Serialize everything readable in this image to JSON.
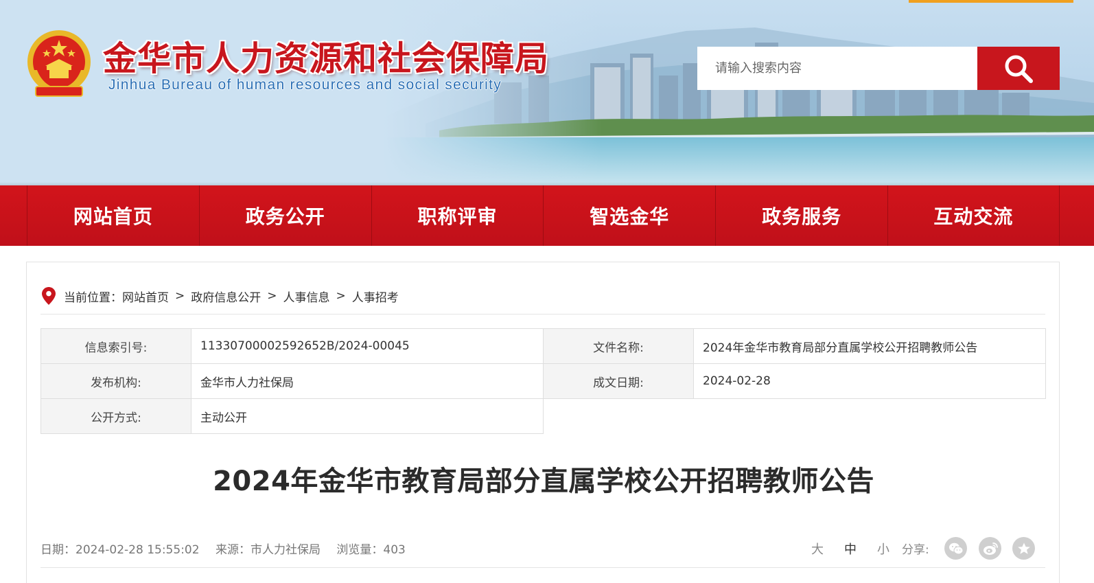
{
  "header": {
    "title": "金华市人力资源和社会保障局",
    "subtitle": "Jinhua Bureau of human resources and social security",
    "search_placeholder": "请输入搜索内容"
  },
  "nav": {
    "items": [
      {
        "label": "网站首页"
      },
      {
        "label": "政务公开"
      },
      {
        "label": "职称评审"
      },
      {
        "label": "智选金华"
      },
      {
        "label": "政务服务"
      },
      {
        "label": "互动交流"
      }
    ]
  },
  "breadcrumb": {
    "prefix": "当前位置：",
    "items": [
      "网站首页",
      "政府信息公开",
      "人事信息",
      "人事招考"
    ],
    "separator": ">"
  },
  "meta": {
    "index_label": "信息索引号:",
    "index_value": "11330700002592652B/2024-00045",
    "filename_label": "文件名称:",
    "filename_value": "2024年金华市教育局部分直属学校公开招聘教师公告",
    "publisher_label": "发布机构:",
    "publisher_value": "金华市人力社保局",
    "date_label": "成文日期:",
    "date_value": "2024-02-28",
    "mode_label": "公开方式:",
    "mode_value": "主动公开"
  },
  "article": {
    "title": "2024年金华市教育局部分直属学校公开招聘教师公告",
    "date_text": "日期：2024-02-28 15:55:02",
    "source_text": "来源：市人力社保局",
    "views_text": "浏览量：403"
  },
  "toolbar": {
    "font_large": "大",
    "font_medium": "中",
    "font_small": "小",
    "share_label": "分享:"
  },
  "colors": {
    "brand_red": "#c8161d",
    "nav_border": "#9e0c12",
    "accent_orange": "#f0a020"
  }
}
